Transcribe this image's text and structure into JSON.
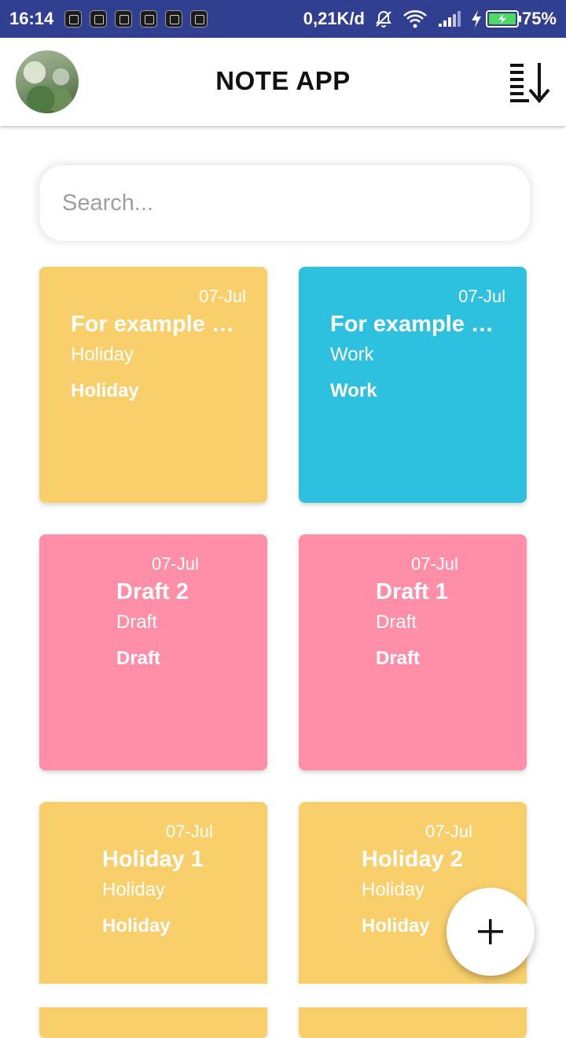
{
  "status_bar": {
    "time": "16:14",
    "network_speed": "0,21K/d",
    "battery_percent": "75%",
    "background": "#303f8f",
    "icons": [
      "notification-icon",
      "notification-icon",
      "notification-icon",
      "notification-icon",
      "notification-icon",
      "notification-icon",
      "mute-bell-icon",
      "wifi-icon",
      "signal-icon",
      "charging-icon",
      "battery-icon"
    ]
  },
  "app_bar": {
    "title": "NOTE APP",
    "sort_icon": "sort-descending-icon",
    "avatar_icon": "profile-photo"
  },
  "search": {
    "placeholder": "Search...",
    "value": ""
  },
  "colors": {
    "holiday": "#f8cf6b",
    "work": "#2ec1df",
    "draft": "#ff8fa8"
  },
  "notes": [
    {
      "date": "07-Jul",
      "title": "For example f...",
      "category": "Holiday",
      "tag": "Holiday",
      "color": "#f8cf6b"
    },
    {
      "date": "07-Jul",
      "title": "For example f...",
      "category": "Work",
      "tag": "Work",
      "color": "#2ec1df"
    },
    {
      "date": "07-Jul",
      "title": "Draft 2",
      "category": "Draft",
      "tag": "Draft",
      "color": "#ff8fa8"
    },
    {
      "date": "07-Jul",
      "title": "Draft 1",
      "category": "Draft",
      "tag": "Draft",
      "color": "#ff8fa8"
    },
    {
      "date": "07-Jul",
      "title": "Holiday 1",
      "category": "Holiday",
      "tag": "Holiday",
      "color": "#f8cf6b"
    },
    {
      "date": "07-Jul",
      "title": "Holiday 2",
      "category": "Holiday",
      "tag": "Holiday",
      "color": "#f8cf6b"
    }
  ],
  "fab": {
    "icon": "plus-icon"
  }
}
